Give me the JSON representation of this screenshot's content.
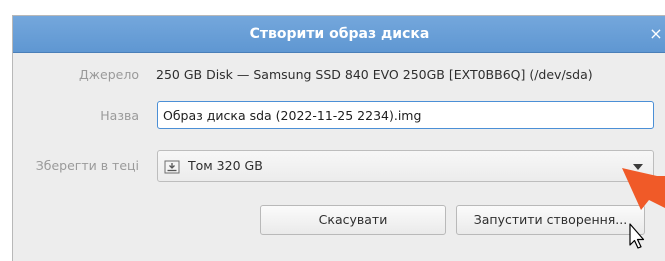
{
  "dialog": {
    "title": "Створити образ диска",
    "close_glyph": "×",
    "source": {
      "label": "Джерело",
      "value": "250 GB Disk — Samsung SSD 840 EVO 250GB [EXT0BB6Q] (/dev/sda)"
    },
    "name": {
      "label": "Назва",
      "value": "Образ диска sda (2022-11-25 2234).img"
    },
    "folder": {
      "label": "Зберегти в теці",
      "value": "Том 320 GB",
      "icon": "drive-icon"
    },
    "buttons": {
      "cancel": "Скасувати",
      "start": "Запустити створення..."
    }
  },
  "colors": {
    "titlebar": "#6ba1d8",
    "annotation_arrow": "#f05a28",
    "focus_border": "#4b8fd6"
  },
  "icons": [
    "close-icon",
    "drive-icon",
    "dropdown-arrow-icon",
    "mouse-pointer-icon",
    "annotation-arrow-icon"
  ]
}
